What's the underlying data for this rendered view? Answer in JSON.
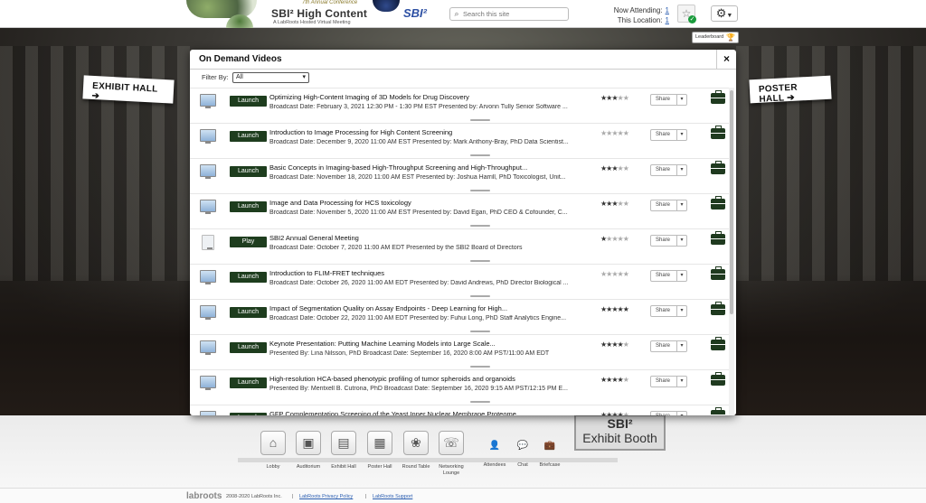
{
  "header": {
    "conference_sub": "7th Annual Conference",
    "conference_title": "SBI² High Content",
    "conference_tagline": "A LabRoots Hosted Virtual Meeting",
    "sbi_logo": "SBI²",
    "search_placeholder": "Search this site",
    "now_attending_label": "Now Attending:",
    "now_attending_value": "1",
    "this_location_label": "This Location:",
    "this_location_value": "1"
  },
  "scene": {
    "exhibit_hall_sign": "EXHIBIT HALL ➔",
    "poster_hall_sign": "POSTER HALL ➔",
    "leaderboard": "Leaderboard",
    "booth_line1": "SBI²",
    "booth_line2": "Exhibit Booth"
  },
  "modal": {
    "title": "On Demand Videos",
    "close": "×",
    "filter_label": "Filter By:",
    "filter_value": "All",
    "rows": [
      {
        "button": "Launch",
        "icon": "monitor",
        "title": "Optimizing High-Content Imaging of 3D Models for Drug Discovery",
        "desc": "Broadcast Date: February 3, 2021 12:30 PM - 1:30 PM EST Presented by: Arvonn Tully Senior Software ...",
        "rating": 3,
        "share": "Share"
      },
      {
        "button": "Launch",
        "icon": "monitor",
        "title": "Introduction to Image Processing for High Content Screening",
        "desc": "Broadcast Date: December 9, 2020 11:00 AM EST Presented by: Mark Anthony-Bray, PhD Data Scientist...",
        "rating": 0,
        "share": "Share"
      },
      {
        "button": "Launch",
        "icon": "monitor",
        "title": "Basic Concepts in Imaging-based High-Throughput Screening and High-Throughput...",
        "desc": "Broadcast Date: November 18, 2020 11:00 AM EST Presented by: Joshua Harrill, PhD Toxicologist, Unit...",
        "rating": 3,
        "share": "Share"
      },
      {
        "button": "Launch",
        "icon": "monitor",
        "title": "Image and Data Processing for HCS toxicology",
        "desc": "Broadcast Date: November 5, 2020 11:00 AM EST Presented by: David Egan, PhD CEO & Cofounder, C...",
        "rating": 3,
        "share": "Share"
      },
      {
        "button": "Play",
        "icon": "document",
        "title": "SBI2 Annual General Meeting",
        "desc": "Broadcast Date: October 7, 2020 11:00 AM EDT Presented by the SBI2 Board of Directors",
        "rating": 1,
        "share": "Share"
      },
      {
        "button": "Launch",
        "icon": "monitor",
        "title": "Introduction to FLIM-FRET techniques",
        "desc": "Broadcast Date: October 26, 2020 11:00 AM EDT Presented by: David Andrews, PhD Director Biological ...",
        "rating": 0,
        "share": "Share"
      },
      {
        "button": "Launch",
        "icon": "monitor",
        "title": "Impact of Segmentation Quality on Assay Endpoints - Deep Learning for High...",
        "desc": "Broadcast Date: October 22, 2020 11:00 AM EDT Presented by: Fuhui Long, PhD Staff Analytics Engine...",
        "rating": 5,
        "share": "Share"
      },
      {
        "button": "Launch",
        "icon": "monitor",
        "title": "Keynote Presentation: Putting Machine Learning Models into Large Scale...",
        "desc": "Presented By: Lina Nilsson, PhD Broadcast Date: September 16, 2020 8:00 AM PST/11:00 AM EDT",
        "rating": 4,
        "share": "Share"
      },
      {
        "button": "Launch",
        "icon": "monitor",
        "title": "High-resolution HCA-based phenotypic profiling of tumor spheroids and organoids",
        "desc": "Presented By: Meritxell B. Cutrona, PhD Broadcast Date: September 16, 2020 9:15 AM PST/12:15 PM E...",
        "rating": 4,
        "share": "Share"
      },
      {
        "button": "Launch",
        "icon": "monitor",
        "title": "GFP Complementation Screening of the Yeast Inner Nuclear Membrane Proteome",
        "desc": "",
        "rating": 4,
        "share": "Share"
      }
    ]
  },
  "nav": [
    {
      "label": "Lobby",
      "icon": "house-icon",
      "glyph": "⌂"
    },
    {
      "label": "Auditorium",
      "icon": "presenter-icon",
      "glyph": "▣"
    },
    {
      "label": "Exhibit Hall",
      "icon": "booth-icon",
      "glyph": "▤"
    },
    {
      "label": "Poster Hall",
      "icon": "poster-icon",
      "glyph": "▦"
    },
    {
      "label": "Round Table",
      "icon": "round-table-icon",
      "glyph": "❀"
    },
    {
      "label": "Networking Lounge",
      "icon": "chat-bubbles-icon",
      "glyph": "☏"
    },
    {
      "label": "Attendees",
      "icon": "person-icon",
      "glyph": "👤"
    },
    {
      "label": "Chat",
      "icon": "chat-icon",
      "glyph": "💬"
    },
    {
      "label": "Briefcase",
      "icon": "briefcase-icon",
      "glyph": "💼"
    }
  ],
  "footer": {
    "brand": "labroots",
    "copyright": "2008-2020 LabRoots Inc.",
    "sep": "|",
    "privacy": "LabRoots Privacy Policy",
    "support": "LabRoots Support"
  },
  "colors": {
    "launch_button": "#1e3d1e",
    "link": "#2a5db0"
  }
}
